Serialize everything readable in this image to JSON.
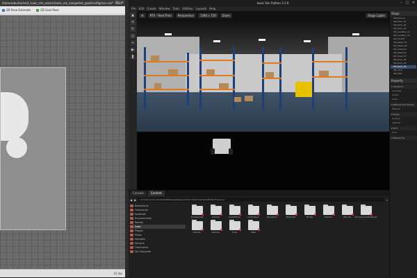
{
  "rviz": {
    "title": "/home/ubuntu/ros2_isaac_sim_ws/src/isaac_ros_navigation_goal/config/nav.rviz* - RViz",
    "tools": [
      {
        "label": "2D Pose Estimate",
        "color": "#3b6fd6"
      },
      {
        "label": "2D Goal Pose",
        "color": "#3a9d3a"
      }
    ],
    "fps": "31 fps"
  },
  "isaac": {
    "title": "Isaac Sim Python 2.1.0",
    "menu": [
      "File",
      "Edit",
      "Create",
      "Window",
      "Tools",
      "Utilities",
      "Layouts",
      "Help"
    ],
    "viewport_toolbar": [
      "RTX - Real-Time",
      "Perspective",
      "1280 x 720",
      "Zoom"
    ],
    "viewport_right": [
      "Stage Lights"
    ],
    "stage_tab": "Stage",
    "stage_items": [
      "Warehouse",
      "SM_Rack_01",
      "SM_Rack_02",
      "SM_Rack_03",
      "SM_CardBox_01",
      "SM_CardBox_02",
      "SM_Forklift",
      "SM_Pallet_01",
      "SM_Pallet_02",
      "SM_Shelf_01",
      "SM_Shelf_02",
      "SM_Shelf_03",
      "SM_Rack_04",
      "SM_Rack_05",
      "SM_Rack_06",
      "SM_Floor",
      "SM_Wall"
    ],
    "selected_stage_item": "SM_Rack_06",
    "property_tab": "Property",
    "properties": [
      {
        "section": "Transform",
        "rows": [
          "Translate",
          "Orient",
          "Scale"
        ]
      },
      {
        "section": "Material and Shader",
        "rows": [
          "Material"
        ]
      },
      {
        "section": "Visual",
        "rows": [
          "Purpose",
          "Visibility"
        ]
      },
      {
        "section": "Kind",
        "rows": [
          "Kind"
        ]
      },
      {
        "section": "References",
        "rows": []
      }
    ]
  },
  "content": {
    "tabs": [
      "Console",
      "Content"
    ],
    "active_tab": "Content",
    "path": "omniverse://localhost/NVIDIA/Assets/Isaac/2022.1/Isaac/Samples/ROS2/Scenario/",
    "tree": [
      {
        "label": "Bookmarks",
        "selected": false
      },
      {
        "label": "Omniverse",
        "selected": false
      },
      {
        "label": "localhost",
        "selected": false
      },
      {
        "label": "Environments",
        "selected": false
      },
      {
        "label": "Robots",
        "selected": false
      },
      {
        "label": "Isaac",
        "selected": true
      },
      {
        "label": "People",
        "selected": false
      },
      {
        "label": "Props",
        "selected": false
      },
      {
        "label": "Samples",
        "selected": false
      },
      {
        "label": "Sensors",
        "selected": false
      },
      {
        "label": "Omniverse",
        "selected": false
      },
      {
        "label": "My Computer",
        "selected": false
      }
    ],
    "folders": [
      "Accessories",
      "Animals",
      "AutoMotive",
      "Controllers",
      "Dynamics",
      "Materials",
      "Mocap",
      "Objects",
      "Policies",
      "Procedural Variations",
      "Robots",
      "Sensors",
      "Tools",
      "Tests"
    ]
  }
}
